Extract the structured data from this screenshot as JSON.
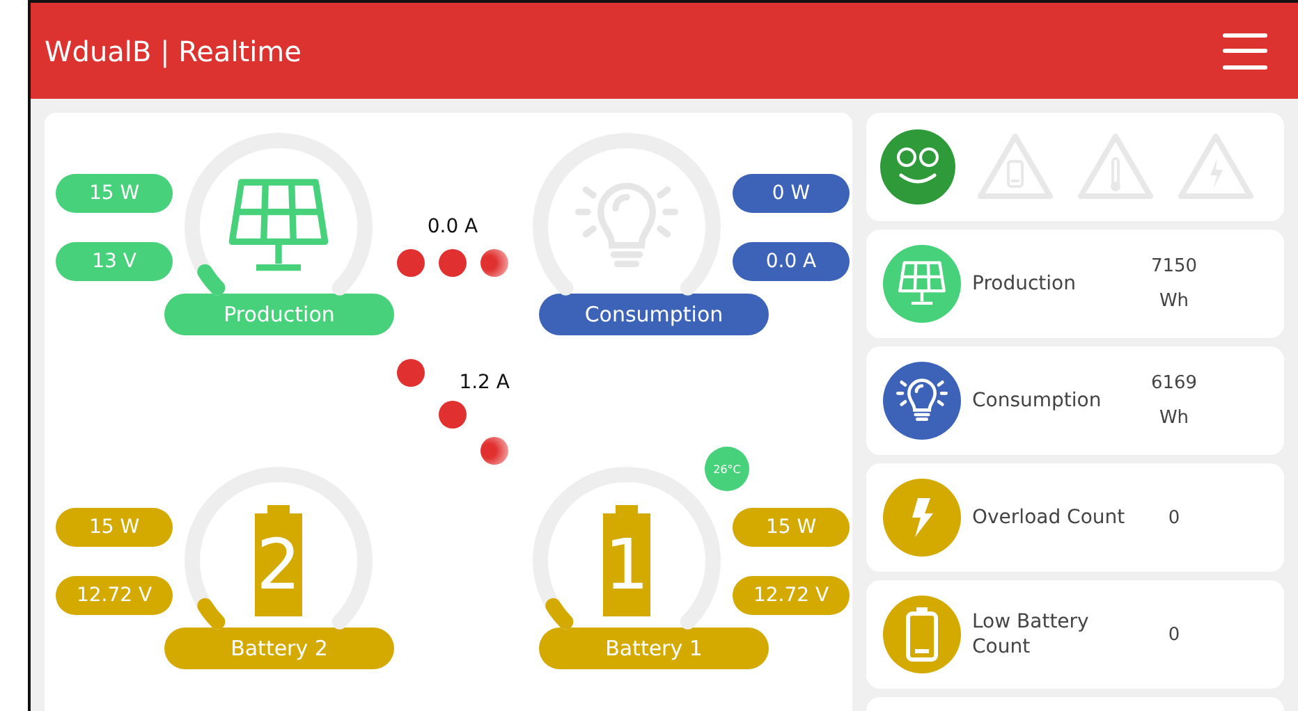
{
  "header": {
    "title": "WdualB | Realtime"
  },
  "gauges": [
    {
      "kind": "solar",
      "label": "Production",
      "color": "#47d17b",
      "readings": [
        "15 W",
        "13 V"
      ]
    },
    {
      "kind": "bulb",
      "label": "Consumption",
      "color": "#3d63b8",
      "readings": [
        "0 W",
        "0.0 A"
      ]
    },
    {
      "kind": "battery",
      "label": "Battery 2",
      "color": "#d4aa00",
      "number": "2",
      "readings": [
        "15 W",
        "12.72 V"
      ]
    },
    {
      "kind": "battery",
      "label": "Battery 1",
      "color": "#d4aa00",
      "number": "1",
      "temperature": "26°C",
      "readings": [
        "15 W",
        "12.72 V"
      ]
    }
  ],
  "flows": [
    {
      "kind": "horizontal",
      "current": "0.0 A"
    },
    {
      "kind": "diagonal",
      "current": "1.2 A"
    }
  ],
  "status": {
    "alerts": [
      {
        "kind": "battery",
        "active": false
      },
      {
        "kind": "temperature",
        "active": false
      },
      {
        "kind": "overload",
        "active": false
      }
    ]
  },
  "stats": [
    {
      "kind": "solar",
      "color": "#47d17b",
      "label": "Production",
      "value": "7150",
      "unit": "Wh"
    },
    {
      "kind": "bulb",
      "color": "#3d63b8",
      "label": "Consumption",
      "value": "6169",
      "unit": "Wh"
    },
    {
      "kind": "bolt",
      "color": "#d4aa00",
      "label": "Overload Count",
      "value": "0"
    },
    {
      "kind": "battery",
      "color": "#d4aa00",
      "label": "Low Battery Count",
      "value": "0"
    }
  ]
}
